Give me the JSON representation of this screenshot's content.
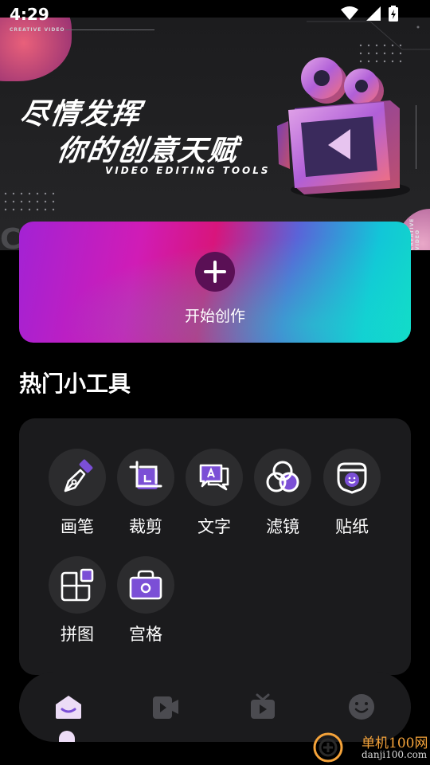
{
  "status_bar": {
    "time": "4:29"
  },
  "banner": {
    "small_label": "CREATIVE VIDEO",
    "title_line1": "尽情发挥",
    "title_line2": "你的创意天赋",
    "subtitle": "VIDEO EDITING TOOLS",
    "vertical_label": "CREATIVE VIDEO",
    "bg_text": "CR"
  },
  "start_card": {
    "label": "开始创作"
  },
  "section": {
    "title": "热门小工具"
  },
  "tools": [
    {
      "label": "画笔",
      "icon": "pen-icon"
    },
    {
      "label": "裁剪",
      "icon": "crop-icon"
    },
    {
      "label": "文字",
      "icon": "text-bubble-icon"
    },
    {
      "label": "滤镜",
      "icon": "filter-icon"
    },
    {
      "label": "贴纸",
      "icon": "sticker-icon"
    },
    {
      "label": "拼图",
      "icon": "collage-icon"
    },
    {
      "label": "宫格",
      "icon": "grid-icon"
    }
  ],
  "bottom_nav": [
    {
      "name": "home",
      "icon": "home-icon",
      "active": true
    },
    {
      "name": "video",
      "icon": "video-icon",
      "active": false
    },
    {
      "name": "tv",
      "icon": "tv-icon",
      "active": false
    },
    {
      "name": "profile",
      "icon": "smile-icon",
      "active": false
    }
  ],
  "colors": {
    "accent": "#7b4fd6",
    "icon_stroke": "#ffffff",
    "panel": "#1b1b1d",
    "circle": "#2c2c2e"
  },
  "watermark": {
    "title": "单机100网",
    "url": "danji100.com"
  }
}
